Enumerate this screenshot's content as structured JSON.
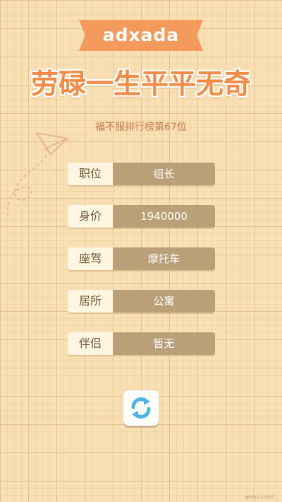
{
  "header": {
    "app_name": "adxada",
    "title": "劳碌一生平平无奇",
    "ranking": "福不服排行榜第67位"
  },
  "info": {
    "rows": [
      {
        "label": "职位",
        "value": "组长"
      },
      {
        "label": "身价",
        "value": "1940000"
      },
      {
        "label": "座驾",
        "value": "摩托车"
      },
      {
        "label": "居所",
        "value": "公寓"
      },
      {
        "label": "伴侣",
        "value": "暂无"
      }
    ]
  },
  "icons": {
    "plane": "paper-plane-icon",
    "refresh": "refresh-icon"
  },
  "colors": {
    "background": "#f8dfb4",
    "ribbon": "#f39a5c",
    "title": "#f48b45",
    "value_box": "#b9a078",
    "label_box": "#fff6e2",
    "refresh_arrow": "#49b3e4"
  },
  "watermark": "weibo.com/..."
}
